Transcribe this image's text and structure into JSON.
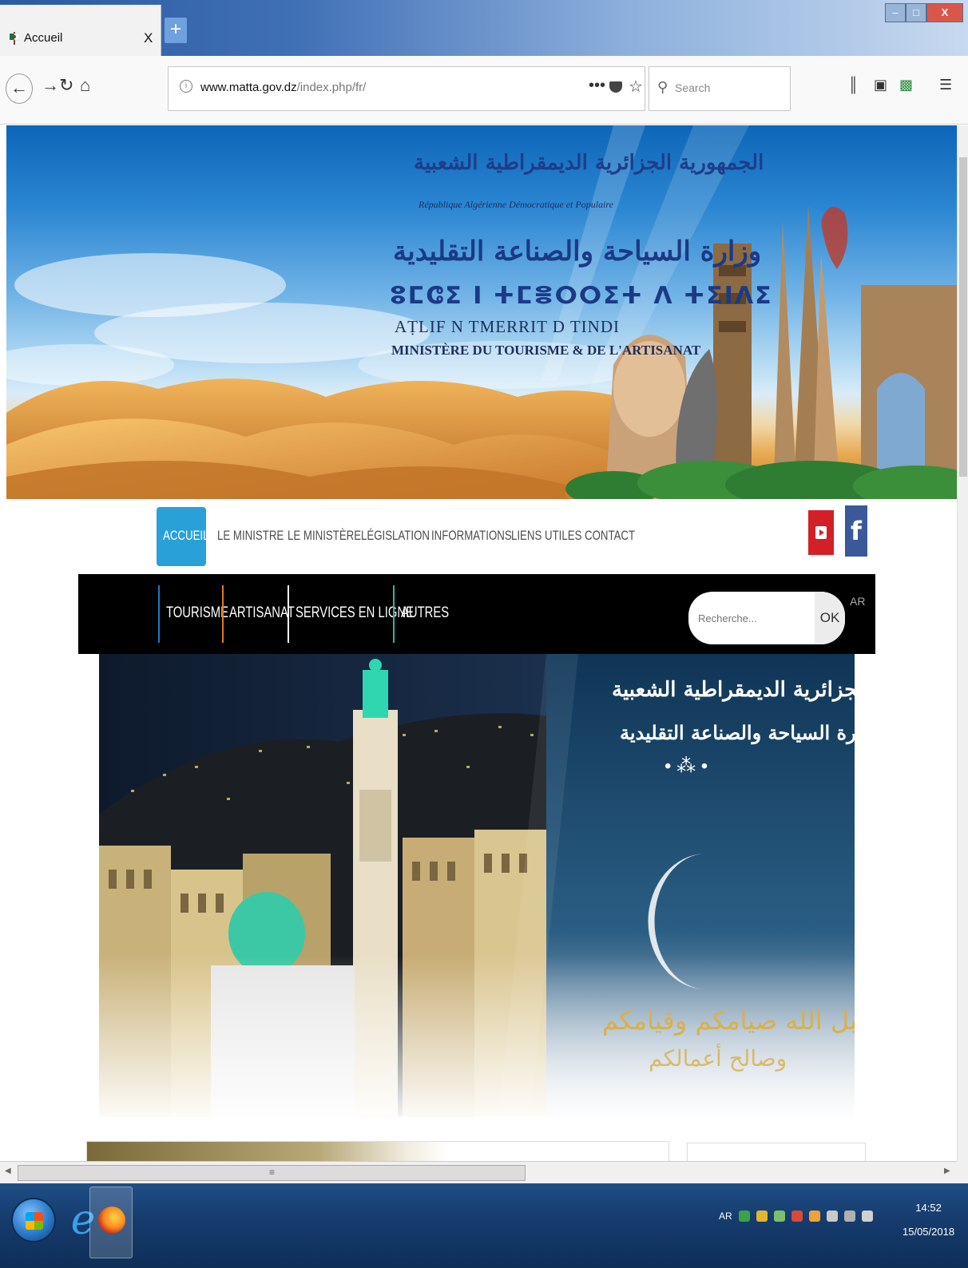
{
  "browser": {
    "tab_title": "Accueil",
    "tab_close": "X",
    "new_tab": "+",
    "url_domain": "www.matta.gov.dz",
    "url_path": "/index.php/fr/",
    "search_placeholder": "Search",
    "page_actions": "•••",
    "window_min": "–",
    "window_max": "□",
    "window_close": "X"
  },
  "banner": {
    "arabic_republic": "الجمهورية الجزائرية الديمقراطية الشعبية",
    "french_republic": "République Algérienne Démocratique et Populaire",
    "arabic_ministry": "وزارة السياحة والصناعة التقليدية",
    "tifinagh": "ⵓⵎⵛⵉ ⵏ ⵜⵎⴻⵔⵔⵉⵜ ⴷ ⵜⵉⵏⴷⵉ",
    "latin_berber": "AṬLIF  N TMERRIT D TINDI",
    "french_ministry": "MINISTÈRE DU TOURISME & DE L'ARTISANAT"
  },
  "main_menu": {
    "items": [
      "ACCUEIL",
      "LE MINISTRE",
      "LE MINISTÈRE",
      "LÉGISLATION",
      "INFORMATIONS",
      "LIENS UTILES",
      "CONTACT"
    ],
    "active": "ACCUEIL",
    "social": [
      "youtube",
      "facebook"
    ],
    "facebook_glyph": "f"
  },
  "sub_menu": {
    "items": [
      "TOURISME",
      "ARTISANAT",
      "SERVICES EN LIGNE",
      "AUTRES"
    ],
    "separator_colors": [
      "#1f78c8",
      "#e07b24",
      "#ffffff",
      "#2fb6a6"
    ],
    "search_placeholder": "Recherche...",
    "search_button": "OK",
    "lang_switch": "AR"
  },
  "slide": {
    "arabic_republic": "الجمهورية الجزائرية الديمقراطية الشعبية",
    "arabic_ministry": "وزارة السياحة والصناعة التقليدية",
    "ornament": "• ⁂ •",
    "greeting_line1": "تقبل الله صيامكم وقيامكم",
    "greeting_line2": "وصالح أعمالكم"
  },
  "scrollbar": {
    "h_left": "◀",
    "h_right": "▶",
    "h_grip": "≡"
  },
  "taskbar": {
    "lang": "AR",
    "time": "14:52",
    "date": "15/05/2018"
  }
}
